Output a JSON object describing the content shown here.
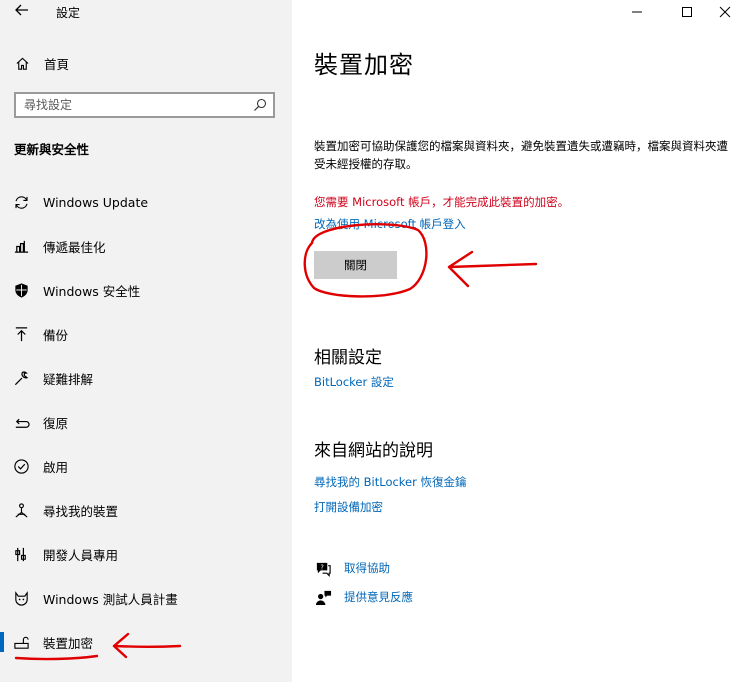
{
  "app": {
    "title": "設定",
    "back_icon": "arrow-left-icon"
  },
  "window_controls": {
    "minimize_icon": "minimize-icon",
    "maximize_icon": "maximize-icon",
    "close_icon": "close-icon"
  },
  "sidebar": {
    "home_label": "首頁",
    "search_placeholder": "尋找設定",
    "section_title": "更新與安全性",
    "items": [
      {
        "label": "Windows Update",
        "icon": "sync-icon"
      },
      {
        "label": "傳遞最佳化",
        "icon": "delivery-optimization-icon"
      },
      {
        "label": "Windows 安全性",
        "icon": "shield-icon"
      },
      {
        "label": "備份",
        "icon": "backup-arrow-icon"
      },
      {
        "label": "疑難排解",
        "icon": "wrench-icon"
      },
      {
        "label": "復原",
        "icon": "recovery-icon"
      },
      {
        "label": "啟用",
        "icon": "check-circle-icon"
      },
      {
        "label": "尋找我的裝置",
        "icon": "find-device-icon"
      },
      {
        "label": "開發人員專用",
        "icon": "developer-icon"
      },
      {
        "label": "Windows 測試人員計畫",
        "icon": "insider-cat-icon"
      },
      {
        "label": "裝置加密",
        "icon": "device-encryption-icon",
        "selected": true
      }
    ]
  },
  "main": {
    "title": "裝置加密",
    "description": "裝置加密可協助保護您的檔案與資料夾，避免裝置遺失或遭竊時，檔案與資料夾遭受未經授權的存取。",
    "warning": "您需要 Microsoft 帳戶，才能完成此裝置的加密。",
    "switch_link": "改為使用 Microsoft 帳戶登入",
    "off_button": "關閉",
    "related": {
      "heading": "相關設定",
      "links": [
        "BitLocker 設定"
      ]
    },
    "web_help": {
      "heading": "來自網站的說明",
      "links": [
        "尋找我的 BitLocker 恢復金鑰",
        "打開設備加密"
      ]
    },
    "help_links": [
      {
        "label": "取得協助",
        "icon": "help-chat-icon"
      },
      {
        "label": "提供意見反應",
        "icon": "feedback-icon"
      }
    ]
  },
  "colors": {
    "accent": "#0067c0",
    "link": "#0067b8",
    "warning": "#d0021b",
    "annotation": "#e00000",
    "sidebar_bg": "#f2f2f2"
  }
}
